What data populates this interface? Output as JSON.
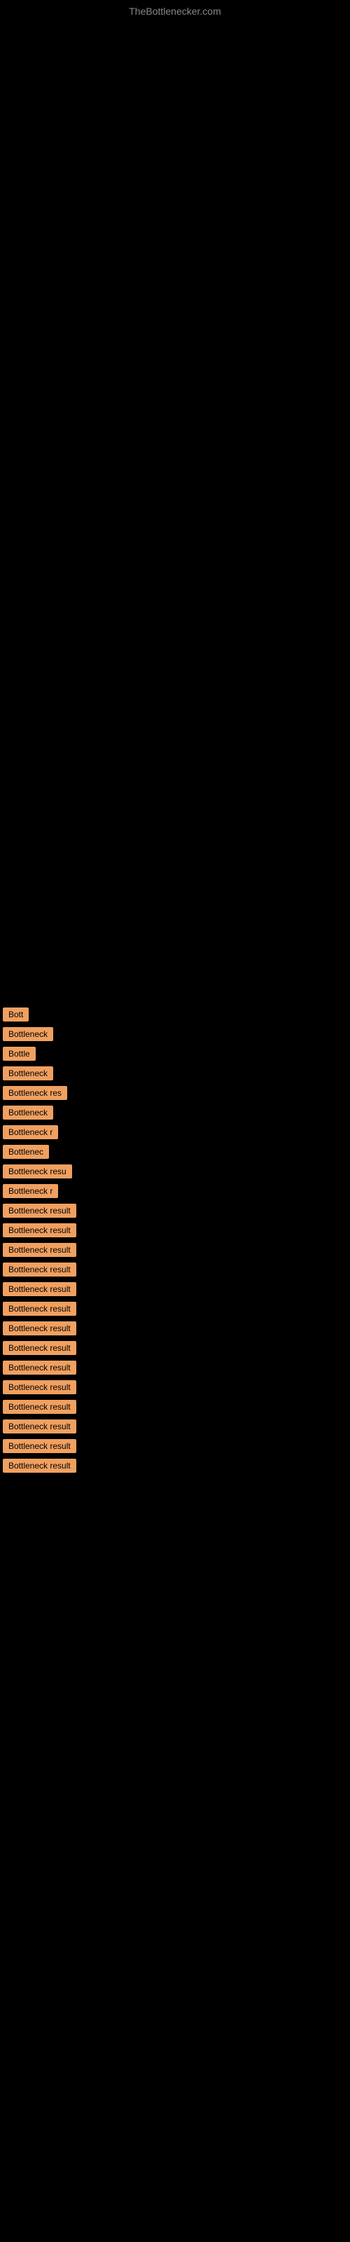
{
  "site": {
    "title": "TheBottlenecker.com"
  },
  "results": [
    {
      "label": "Bott"
    },
    {
      "label": "Bottleneck"
    },
    {
      "label": "Bottle"
    },
    {
      "label": "Bottleneck"
    },
    {
      "label": "Bottleneck res"
    },
    {
      "label": "Bottleneck"
    },
    {
      "label": "Bottleneck r"
    },
    {
      "label": "Bottlenec"
    },
    {
      "label": "Bottleneck resu"
    },
    {
      "label": "Bottleneck r"
    },
    {
      "label": "Bottleneck result"
    },
    {
      "label": "Bottleneck result"
    },
    {
      "label": "Bottleneck result"
    },
    {
      "label": "Bottleneck result"
    },
    {
      "label": "Bottleneck result"
    },
    {
      "label": "Bottleneck result"
    },
    {
      "label": "Bottleneck result"
    },
    {
      "label": "Bottleneck result"
    },
    {
      "label": "Bottleneck result"
    },
    {
      "label": "Bottleneck result"
    },
    {
      "label": "Bottleneck result"
    },
    {
      "label": "Bottleneck result"
    },
    {
      "label": "Bottleneck result"
    },
    {
      "label": "Bottleneck result"
    }
  ],
  "colors": {
    "background": "#000000",
    "badge": "#f0a060",
    "title": "#888888"
  }
}
